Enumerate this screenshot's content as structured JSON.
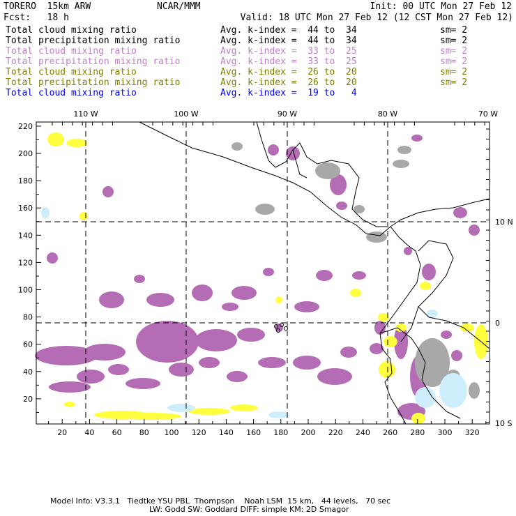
{
  "header": {
    "model": "TORERO  15km ARW",
    "org": "NCAR/MMM",
    "init": "Init: 00 UTC Mon 27 Feb 12",
    "fcst": "Fcst:   18 h",
    "valid": "Valid: 18 UTC Mon 27 Feb 12 (12 CST Mon 27 Feb 12)"
  },
  "legend": [
    {
      "field": "Total cloud mixing ratio",
      "range": "Avg. k-index =  44 to  34",
      "sm": "sm= 2",
      "color": "#000000"
    },
    {
      "field": "Total precipitation mixing ratio",
      "range": "Avg. k-index =  44 to  34",
      "sm": "sm= 2",
      "color": "#000000"
    },
    {
      "field": "Total cloud mixing ratio",
      "range": "Avg. k-index =  33 to  25",
      "sm": "sm= 2",
      "color": "#c080c8"
    },
    {
      "field": "Total precipitation mixing ratio",
      "range": "Avg. k-index =  33 to  25",
      "sm": "sm= 2",
      "color": "#c080c8"
    },
    {
      "field": "Total cloud mixing ratio",
      "range": "Avg. k-index =  26 to  20",
      "sm": "sm= 2",
      "color": "#808000"
    },
    {
      "field": "Total precipitation mixing ratio",
      "range": "Avg. k-index =  26 to  20",
      "sm": "sm= 2",
      "color": "#808000"
    },
    {
      "field": "Total cloud mixing ratio",
      "range": "Avg. k-index =  19 to   4",
      "sm": "",
      "color": "#0000ff"
    }
  ],
  "map": {
    "lon_labels": [
      "110 W",
      "100 W",
      "90 W",
      "80 W",
      "70 W"
    ],
    "lat_labels": [
      "10 N",
      "0",
      "10 S"
    ],
    "x_ticks": [
      "20",
      "40",
      "60",
      "80",
      "100",
      "120",
      "140",
      "160",
      "180",
      "200",
      "220",
      "240",
      "260",
      "280",
      "300",
      "320"
    ],
    "y_ticks": [
      "20",
      "40",
      "60",
      "80",
      "100",
      "120",
      "140",
      "160",
      "180",
      "200",
      "220"
    ],
    "colors": {
      "purple": "#b46cb4",
      "gray": "#a8a8a8",
      "yellow": "#ffff40",
      "lightblue": "#cfeefc"
    }
  },
  "footer": {
    "line1": "Model Info: V3.3.1   Tiedtke YSU PBL  Thompson    Noah LSM  15 km,   44 levels,   70 sec",
    "line2": "LW: Godd SW: Goddard DIFF: simple KM: 2D Smagor"
  }
}
